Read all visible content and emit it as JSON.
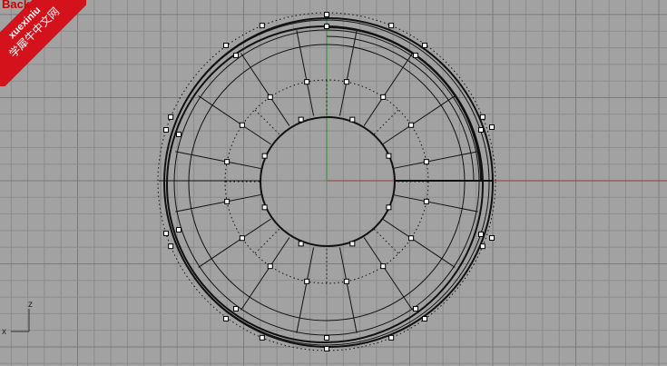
{
  "viewport": {
    "background": "#a2a2a2",
    "x_axis_color": "#9a3b3b",
    "y_axis_color": "#2e8b2e",
    "gizmo": {
      "x_label": "x",
      "z_label": "z"
    }
  },
  "watermark": {
    "back_label": "Back",
    "brand": "xuexiniu",
    "cn_text": "学犀牛中文网",
    "color": "#d3121b"
  },
  "icons": [
    "grid-icon",
    "axis-gizmo-icon"
  ]
}
